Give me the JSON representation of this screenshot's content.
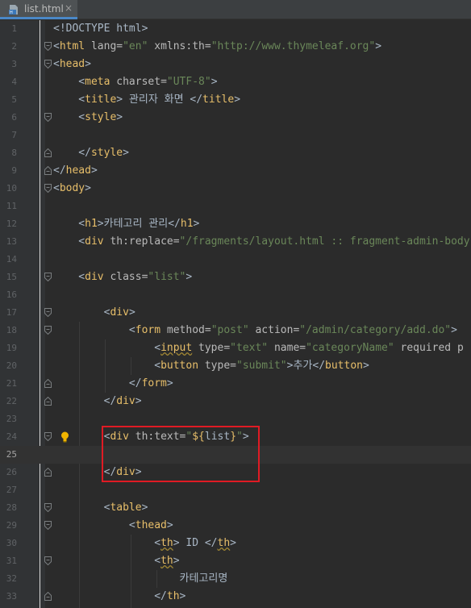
{
  "tab": {
    "label": "list.html",
    "close": "×",
    "icon": "html-file-icon"
  },
  "colors": {
    "highlight_box": "#e01b24",
    "background": "#2b2b2b",
    "tag": "#e8bf6a",
    "string": "#6a8759"
  },
  "lines": [
    {
      "n": "1",
      "fold": "",
      "tokens": [
        {
          "t": "<!DOCTYPE html>",
          "c": "txt"
        }
      ]
    },
    {
      "n": "2",
      "fold": "open",
      "tokens": [
        {
          "t": "<",
          "c": "txt"
        },
        {
          "t": "html",
          "c": "tag"
        },
        {
          "t": " lang=",
          "c": "attr"
        },
        {
          "t": "\"en\"",
          "c": "str"
        },
        {
          "t": " xmlns:th=",
          "c": "attr"
        },
        {
          "t": "\"http://www.thymeleaf.org\"",
          "c": "str"
        },
        {
          "t": ">",
          "c": "txt"
        }
      ]
    },
    {
      "n": "3",
      "fold": "open",
      "tokens": [
        {
          "t": "<",
          "c": "txt"
        },
        {
          "t": "head",
          "c": "tag"
        },
        {
          "t": ">",
          "c": "txt"
        }
      ]
    },
    {
      "n": "4",
      "fold": "",
      "tokens": [
        {
          "t": "    <",
          "c": "txt"
        },
        {
          "t": "meta",
          "c": "tag"
        },
        {
          "t": " charset=",
          "c": "attr"
        },
        {
          "t": "\"UTF-8\"",
          "c": "str"
        },
        {
          "t": ">",
          "c": "txt"
        }
      ]
    },
    {
      "n": "5",
      "fold": "",
      "tokens": [
        {
          "t": "    <",
          "c": "txt"
        },
        {
          "t": "title",
          "c": "tag"
        },
        {
          "t": "> 관리자 화면 </",
          "c": "txt"
        },
        {
          "t": "title",
          "c": "tag"
        },
        {
          "t": ">",
          "c": "txt"
        }
      ]
    },
    {
      "n": "6",
      "fold": "open",
      "tokens": [
        {
          "t": "    <",
          "c": "txt"
        },
        {
          "t": "style",
          "c": "tag"
        },
        {
          "t": ">",
          "c": "txt"
        }
      ]
    },
    {
      "n": "7",
      "fold": "",
      "tokens": []
    },
    {
      "n": "8",
      "fold": "close",
      "tokens": [
        {
          "t": "    </",
          "c": "txt"
        },
        {
          "t": "style",
          "c": "tag"
        },
        {
          "t": ">",
          "c": "txt"
        }
      ]
    },
    {
      "n": "9",
      "fold": "close",
      "tokens": [
        {
          "t": "</",
          "c": "txt"
        },
        {
          "t": "head",
          "c": "tag"
        },
        {
          "t": ">",
          "c": "txt"
        }
      ]
    },
    {
      "n": "10",
      "fold": "open",
      "tokens": [
        {
          "t": "<",
          "c": "txt"
        },
        {
          "t": "body",
          "c": "tag"
        },
        {
          "t": ">",
          "c": "txt"
        }
      ]
    },
    {
      "n": "11",
      "fold": "",
      "tokens": []
    },
    {
      "n": "12",
      "fold": "",
      "tokens": [
        {
          "t": "    <",
          "c": "txt"
        },
        {
          "t": "h1",
          "c": "tag"
        },
        {
          "t": ">카테고리 관리</",
          "c": "txt"
        },
        {
          "t": "h1",
          "c": "tag"
        },
        {
          "t": ">",
          "c": "txt"
        }
      ]
    },
    {
      "n": "13",
      "fold": "",
      "tokens": [
        {
          "t": "    <",
          "c": "txt"
        },
        {
          "t": "div",
          "c": "tag"
        },
        {
          "t": " th:replace=",
          "c": "attr"
        },
        {
          "t": "\"/fragments/layout.html :: fragment-admin-body",
          "c": "str"
        }
      ]
    },
    {
      "n": "14",
      "fold": "",
      "tokens": []
    },
    {
      "n": "15",
      "fold": "open",
      "tokens": [
        {
          "t": "    <",
          "c": "txt"
        },
        {
          "t": "div",
          "c": "tag"
        },
        {
          "t": " class=",
          "c": "attr"
        },
        {
          "t": "\"list\"",
          "c": "str"
        },
        {
          "t": ">",
          "c": "txt"
        }
      ]
    },
    {
      "n": "16",
      "fold": "",
      "tokens": []
    },
    {
      "n": "17",
      "fold": "open",
      "tokens": [
        {
          "t": "        <",
          "c": "txt"
        },
        {
          "t": "div",
          "c": "tag"
        },
        {
          "t": ">",
          "c": "txt"
        }
      ]
    },
    {
      "n": "18",
      "fold": "open",
      "tokens": [
        {
          "t": "            <",
          "c": "txt"
        },
        {
          "t": "form",
          "c": "tag"
        },
        {
          "t": " method=",
          "c": "attr"
        },
        {
          "t": "\"post\"",
          "c": "str"
        },
        {
          "t": " action=",
          "c": "attr"
        },
        {
          "t": "\"/admin/category/add.do\"",
          "c": "str"
        },
        {
          "t": ">",
          "c": "txt"
        }
      ]
    },
    {
      "n": "19",
      "fold": "",
      "tokens": [
        {
          "t": "                <",
          "c": "txt"
        },
        {
          "t": "input",
          "c": "tag typo"
        },
        {
          "t": " type=",
          "c": "attr"
        },
        {
          "t": "\"text\"",
          "c": "str"
        },
        {
          "t": " name=",
          "c": "attr"
        },
        {
          "t": "\"categoryName\"",
          "c": "str"
        },
        {
          "t": " required p",
          "c": "attr"
        }
      ]
    },
    {
      "n": "20",
      "fold": "",
      "tokens": [
        {
          "t": "                <",
          "c": "txt"
        },
        {
          "t": "button",
          "c": "tag"
        },
        {
          "t": " type=",
          "c": "attr"
        },
        {
          "t": "\"submit\"",
          "c": "str"
        },
        {
          "t": ">추가</",
          "c": "txt"
        },
        {
          "t": "button",
          "c": "tag"
        },
        {
          "t": ">",
          "c": "txt"
        }
      ]
    },
    {
      "n": "21",
      "fold": "close",
      "tokens": [
        {
          "t": "            </",
          "c": "txt"
        },
        {
          "t": "form",
          "c": "tag"
        },
        {
          "t": ">",
          "c": "txt"
        }
      ]
    },
    {
      "n": "22",
      "fold": "close",
      "tokens": [
        {
          "t": "        </",
          "c": "txt"
        },
        {
          "t": "div",
          "c": "tag"
        },
        {
          "t": ">",
          "c": "txt"
        }
      ]
    },
    {
      "n": "23",
      "fold": "",
      "tokens": []
    },
    {
      "n": "24",
      "fold": "open",
      "bulb": true,
      "tokens": [
        {
          "t": "        <",
          "c": "txt"
        },
        {
          "t": "div",
          "c": "tag"
        },
        {
          "t": " th:text=",
          "c": "attr"
        },
        {
          "t": "\"",
          "c": "str"
        },
        {
          "t": "${",
          "c": "tag"
        },
        {
          "t": "list",
          "c": "exp"
        },
        {
          "t": "}",
          "c": "tag"
        },
        {
          "t": "\"",
          "c": "str"
        },
        {
          "t": ">",
          "c": "txt"
        }
      ]
    },
    {
      "n": "25",
      "fold": "",
      "current": true,
      "tokens": []
    },
    {
      "n": "26",
      "fold": "close",
      "tokens": [
        {
          "t": "        </",
          "c": "txt"
        },
        {
          "t": "div",
          "c": "tag"
        },
        {
          "t": ">",
          "c": "txt"
        }
      ]
    },
    {
      "n": "27",
      "fold": "",
      "tokens": []
    },
    {
      "n": "28",
      "fold": "open",
      "tokens": [
        {
          "t": "        <",
          "c": "txt"
        },
        {
          "t": "table",
          "c": "tag"
        },
        {
          "t": ">",
          "c": "txt"
        }
      ]
    },
    {
      "n": "29",
      "fold": "open",
      "tokens": [
        {
          "t": "            <",
          "c": "txt"
        },
        {
          "t": "thead",
          "c": "tag"
        },
        {
          "t": ">",
          "c": "txt"
        }
      ]
    },
    {
      "n": "30",
      "fold": "",
      "tokens": [
        {
          "t": "                <",
          "c": "txt"
        },
        {
          "t": "th",
          "c": "tag typo"
        },
        {
          "t": "> ID </",
          "c": "txt"
        },
        {
          "t": "th",
          "c": "tag typo"
        },
        {
          "t": ">",
          "c": "txt"
        }
      ]
    },
    {
      "n": "31",
      "fold": "open",
      "tokens": [
        {
          "t": "                <",
          "c": "txt"
        },
        {
          "t": "th",
          "c": "tag typo"
        },
        {
          "t": ">",
          "c": "txt"
        }
      ]
    },
    {
      "n": "32",
      "fold": "",
      "tokens": [
        {
          "t": "                    카테고리명",
          "c": "txt"
        }
      ]
    },
    {
      "n": "33",
      "fold": "close",
      "tokens": [
        {
          "t": "                </",
          "c": "txt"
        },
        {
          "t": "th",
          "c": "tag"
        },
        {
          "t": ">",
          "c": "txt"
        }
      ]
    }
  ]
}
